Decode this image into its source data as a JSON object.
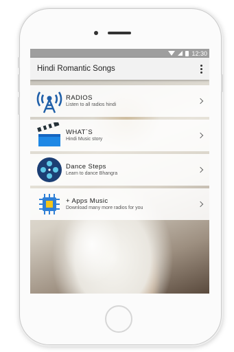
{
  "status_bar": {
    "time": "12:30"
  },
  "app_bar": {
    "title": "Hindi Romantic Songs",
    "menu_icon": "overflow-menu-icon"
  },
  "items": [
    {
      "title": "RADIOS",
      "subtitle": "Listen to all radios hindi",
      "icon": "radio-tower-icon"
    },
    {
      "title": "WHAT`S",
      "subtitle": "Hindi Music story",
      "icon": "clapperboard-icon"
    },
    {
      "title": "Dance Steps",
      "subtitle": "Learn to dance Bhangra",
      "icon": "film-reel-icon"
    },
    {
      "title": "+ Apps Music",
      "subtitle": "Download many more radios for you",
      "icon": "chip-icon"
    }
  ],
  "colors": {
    "status_bar": "#9e9e9e",
    "app_bar": "#f2f2f2",
    "radio_icon": "#1f5fa8",
    "clapper_icon": "#1e88e5",
    "reel_icon": "#1c3f74",
    "chip_icon": "#2f7fd6",
    "chip_core": "#f5c518"
  }
}
